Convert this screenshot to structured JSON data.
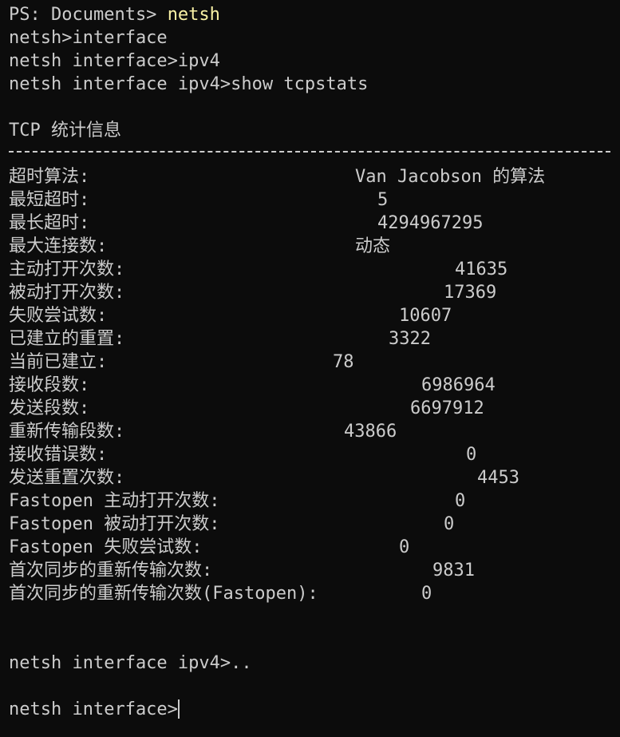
{
  "terminal": {
    "prompt_ps": "PS: Documents> ",
    "cmd_netsh": "netsh",
    "line_interface": "netsh>interface",
    "line_ipv4": "netsh interface>ipv4",
    "line_show": "netsh interface ipv4>show tcpstats",
    "section_title": "TCP 统计信息",
    "stats": [
      {
        "label": "超时算法:",
        "value": "Van Jacobson 的算法"
      },
      {
        "label": "最短超时:",
        "value": "5"
      },
      {
        "label": "最长超时:",
        "value": "4294967295"
      },
      {
        "label": "最大连接数:",
        "value": "动态"
      },
      {
        "label": "主动打开次数:",
        "value": "41635"
      },
      {
        "label": "被动打开次数:",
        "value": "17369"
      },
      {
        "label": "失败尝试数:",
        "value": "10607"
      },
      {
        "label": "已建立的重置:",
        "value": "3322"
      },
      {
        "label": "当前已建立:",
        "value": "78"
      },
      {
        "label": "接收段数:",
        "value": "6986964"
      },
      {
        "label": "发送段数:",
        "value": "6697912"
      },
      {
        "label": "重新传输段数:",
        "value": "43866"
      },
      {
        "label": "接收错误数:",
        "value": "0"
      },
      {
        "label": "发送重置次数:",
        "value": "4453"
      },
      {
        "label": "Fastopen 主动打开次数:",
        "value": "0"
      },
      {
        "label": "Fastopen 被动打开次数:",
        "value": "0"
      },
      {
        "label": "Fastopen 失败尝试数:",
        "value": "0"
      },
      {
        "label": "首次同步的重新传输次数:",
        "value": "9831"
      },
      {
        "label": "首次同步的重新传输次数(Fastopen):",
        "value": "0"
      }
    ],
    "line_dotdot": "netsh interface ipv4>..",
    "line_final": "netsh interface>"
  }
}
